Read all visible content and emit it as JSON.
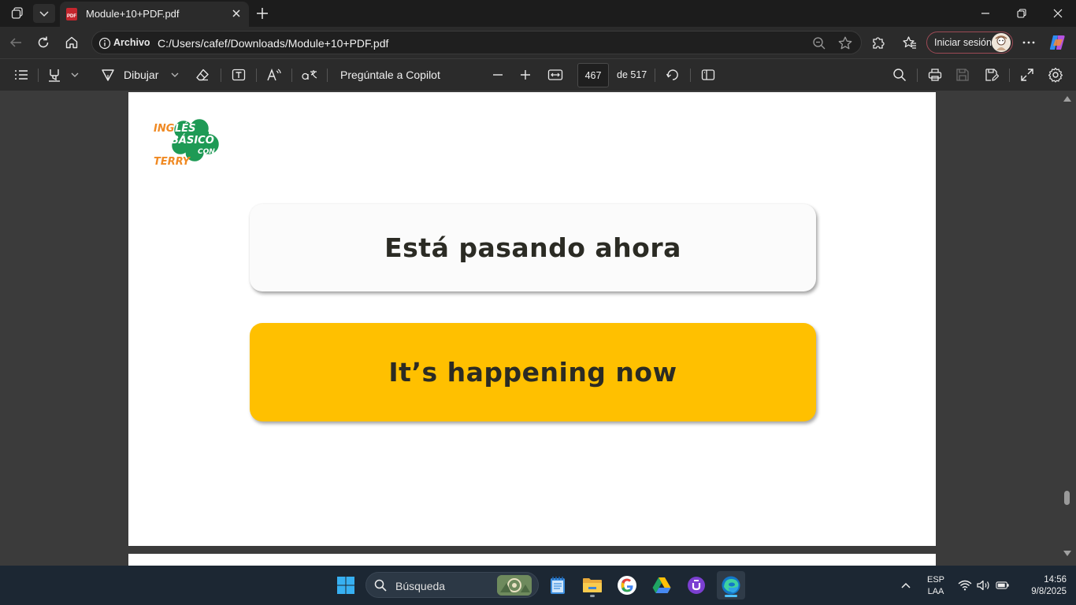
{
  "browser": {
    "tab": {
      "title": "Module+10+PDF.pdf",
      "icon_label": "PDF"
    },
    "address": {
      "scheme_label": "Archivo",
      "url": "C:/Users/cafef/Downloads/Module+10+PDF.pdf"
    },
    "signin_label": "Iniciar sesión"
  },
  "pdf_toolbar": {
    "draw_label": "Dibujar",
    "copilot_label": "Pregúntale a Copilot",
    "current_page": "467",
    "page_count_label": "de 517"
  },
  "document": {
    "logo": {
      "line1": "INGLÉS",
      "line2": "BÁSICO",
      "line3": "CON",
      "line4": "TERRY"
    },
    "card_top_text": "Está pasando ahora",
    "card_bottom_text": "It’s happening now"
  },
  "taskbar": {
    "search_placeholder": "Búsqueda",
    "lang_line1": "ESP",
    "lang_line2": "LAA",
    "time": "14:56",
    "date": "9/8/2025"
  },
  "colors": {
    "accent_yellow": "#ffc000",
    "logo_green": "#1e9a55",
    "logo_orange": "#f08a24",
    "signin_border": "#9c4a55"
  }
}
